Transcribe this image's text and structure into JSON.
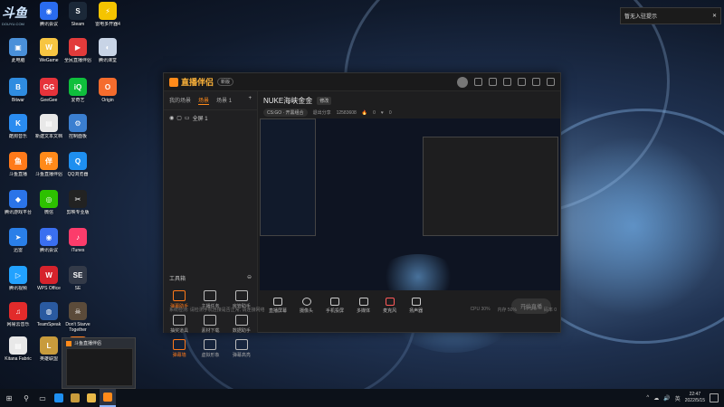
{
  "brand_logo": {
    "text": "斗鱼",
    "sub": "DOUYU.COM"
  },
  "desktop_icons": [
    {
      "label": "腾讯会议",
      "color": "#2a6cf0",
      "glyph": "◉"
    },
    {
      "label": "Steam",
      "color": "#1b2838",
      "glyph": "S"
    },
    {
      "label": "雷电多开器4",
      "color": "#f5c400",
      "glyph": "⚡"
    },
    {
      "label": "此电脑",
      "color": "#4a90d9",
      "glyph": "▣"
    },
    {
      "label": "WeGame",
      "color": "#f7c542",
      "glyph": "W"
    },
    {
      "label": "全民直播伴侣",
      "color": "#e23b3b",
      "glyph": "▶"
    },
    {
      "label": "腾讯课堂",
      "color": "#c8d4e6",
      "glyph": "◐"
    },
    {
      "label": "Bitwar",
      "color": "#2f8ce0",
      "glyph": "B"
    },
    {
      "label": "GeeGee",
      "color": "#e6333b",
      "glyph": "GG"
    },
    {
      "label": "爱奇艺",
      "color": "#0fbf3c",
      "glyph": "iQ"
    },
    {
      "label": "Origin",
      "color": "#f56c2d",
      "glyph": "O"
    },
    {
      "label": "酷狗音乐",
      "color": "#2a8cf0",
      "glyph": "K"
    },
    {
      "label": "新建文本文档",
      "color": "#e8e8e8",
      "glyph": "▤"
    },
    {
      "label": "控制面板",
      "color": "#3b7fd0",
      "glyph": "⚙"
    },
    {
      "label": "斗鱼直播",
      "color": "#ff7a1a",
      "glyph": "鱼"
    },
    {
      "label": "斗鱼直播伴侣",
      "color": "#ff8a1a",
      "glyph": "伴"
    },
    {
      "label": "QQ浏览器",
      "color": "#1e8ff0",
      "glyph": "Q"
    },
    {
      "label": "腾讯游戏平台",
      "color": "#2b74e8",
      "glyph": "◆"
    },
    {
      "label": "微信",
      "color": "#2dc100",
      "glyph": "◎"
    },
    {
      "label": "剪映专业版",
      "color": "#222222",
      "glyph": "✂"
    },
    {
      "label": "迅雷",
      "color": "#2a7fe8",
      "glyph": "➤"
    },
    {
      "label": "腾讯会议",
      "color": "#3a6ff0",
      "glyph": "◉"
    },
    {
      "label": "iTunes",
      "color": "#fc3c6b",
      "glyph": "♪"
    },
    {
      "label": "腾讯视频",
      "color": "#22a2ff",
      "glyph": "▷"
    },
    {
      "label": "WPS Office",
      "color": "#d6232c",
      "glyph": "W"
    },
    {
      "label": "SE",
      "color": "#333a48",
      "glyph": "SE"
    },
    {
      "label": "网易云音乐",
      "color": "#e22b2b",
      "glyph": "♫"
    },
    {
      "label": "TeamSpeak",
      "color": "#2a5aa0",
      "glyph": "◍"
    },
    {
      "label": "Don't Starve Together",
      "color": "#5b4b3a",
      "glyph": "☠"
    },
    {
      "label": "Kitana Fabric",
      "color": "#e8e8e8",
      "glyph": "▤"
    },
    {
      "label": "英雄联盟",
      "color": "#c89b3c",
      "glyph": "L"
    },
    {
      "label": "斗鱼直播伴侣",
      "color": "#ff7a1a",
      "glyph": "伴"
    },
    {
      "label": "uTorrent",
      "color": "#4aa2ea",
      "glyph": "μ"
    },
    {
      "label": "Ultimate Chicken",
      "color": "#e8e8e8",
      "glyph": "▤"
    },
    {
      "label": "WeGame",
      "color": "#f2b233",
      "glyph": "W"
    },
    {
      "label": "暴雪战网",
      "color": "#2e7ee8",
      "glyph": "✦"
    },
    {
      "label": "Epic Games Launcher",
      "color": "#222222",
      "glyph": "EPIC"
    },
    {
      "label": "Launcher",
      "color": "#7a1c1c",
      "glyph": "▲"
    },
    {
      "label": "大乐斗",
      "color": "#3a3a3a",
      "glyph": "◇"
    },
    {
      "label": "QQ游戏",
      "color": "#3e8cf0",
      "glyph": "Q"
    },
    {
      "label": "全民K歌",
      "color": "#ff4f6a",
      "glyph": "K"
    }
  ],
  "notification": {
    "text": "暂无入驻提示",
    "close": "✕"
  },
  "app": {
    "brand": "直播伴侣",
    "version": "新版",
    "left_tabs": [
      "我的场景",
      "场景",
      "场景 1"
    ],
    "scene_name": "全屏 1",
    "tools_title": "工具箱",
    "tools": [
      {
        "label": "弹幕助手",
        "orange": true
      },
      {
        "label": "主播任务",
        "orange": false
      },
      {
        "label": "房管助手",
        "orange": false
      },
      {
        "label": "抽奖道具",
        "orange": false
      },
      {
        "label": "素材下载",
        "orange": false
      },
      {
        "label": "数据助手",
        "orange": false
      },
      {
        "label": "弹幕墙",
        "orange": true
      },
      {
        "label": "虚拟形象",
        "orange": false
      },
      {
        "label": "弹幕高亮",
        "orange": false
      }
    ],
    "room_title": "NUKE海峡金金",
    "room_tag": "修改",
    "category": "CS:GO · 开黑组合",
    "stats": [
      "退出分享",
      "12583608",
      "0",
      "0"
    ],
    "bottom_buttons": [
      "直播屏幕",
      "摄像头",
      "手机投屏",
      "多媒体",
      "麦克风",
      "扬声器"
    ],
    "start_button": "开始直播",
    "status_left": "系统检测: 请检测手机连接是否正常, 请连接网络",
    "status_right": [
      "CPU 30%",
      "内存 50%",
      "FPS 0",
      "码率 0"
    ]
  },
  "thumbnail": {
    "title": "斗鱼直播伴侣"
  },
  "taskbar": {
    "time": "22:47",
    "date": "2022/5/15",
    "tray_lang": "英",
    "tray_items": [
      "^",
      "☁",
      "🔊"
    ]
  }
}
